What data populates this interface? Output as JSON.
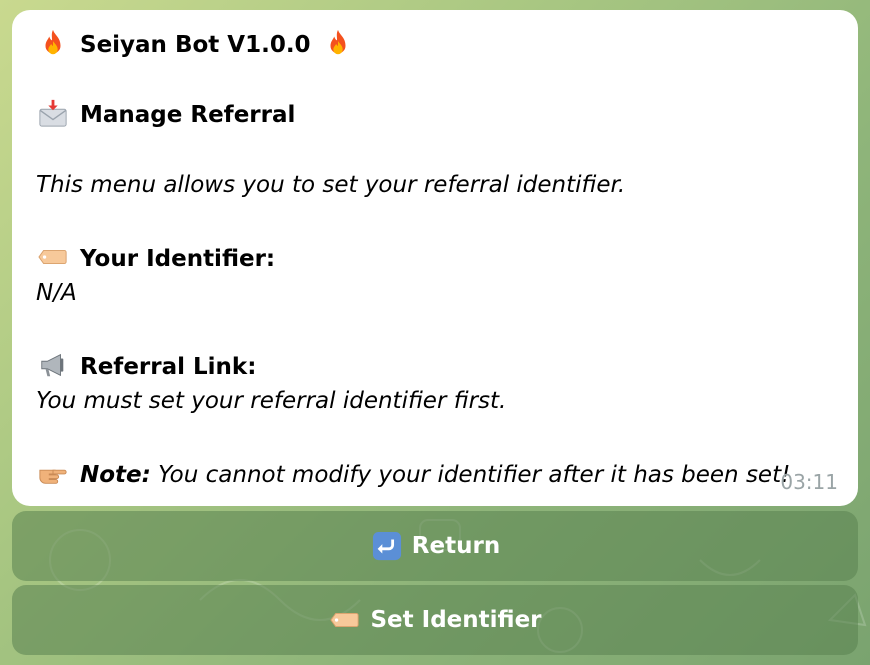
{
  "message": {
    "title": "Seiyan Bot V1.0.0",
    "section_title": "Manage Referral",
    "description": "This menu allows you to set your referral identifier.",
    "identifier_label": "Your Identifier:",
    "identifier_value": "N/A",
    "referral_label": "Referral Link:",
    "referral_value": "You must set your referral identifier first.",
    "note_label": "Note:",
    "note_text": "You cannot modify your identifier after it has been set!",
    "time": "03:11"
  },
  "keyboard": {
    "return_label": "Return",
    "set_identifier_label": "Set Identifier"
  },
  "icons": {
    "title_icon": "fire-icon",
    "section_icon": "envelope-with-arrow-icon",
    "identifier_icon": "label-tag-icon",
    "referral_icon": "megaphone-icon",
    "note_icon": "pointing-hand-icon",
    "return_icon": "return-arrow-icon",
    "set_icon": "label-tag-icon"
  },
  "colors": {
    "bubble": "#ffffff",
    "button_bg": "#6f955f",
    "timestamp": "#9aa4a6"
  }
}
